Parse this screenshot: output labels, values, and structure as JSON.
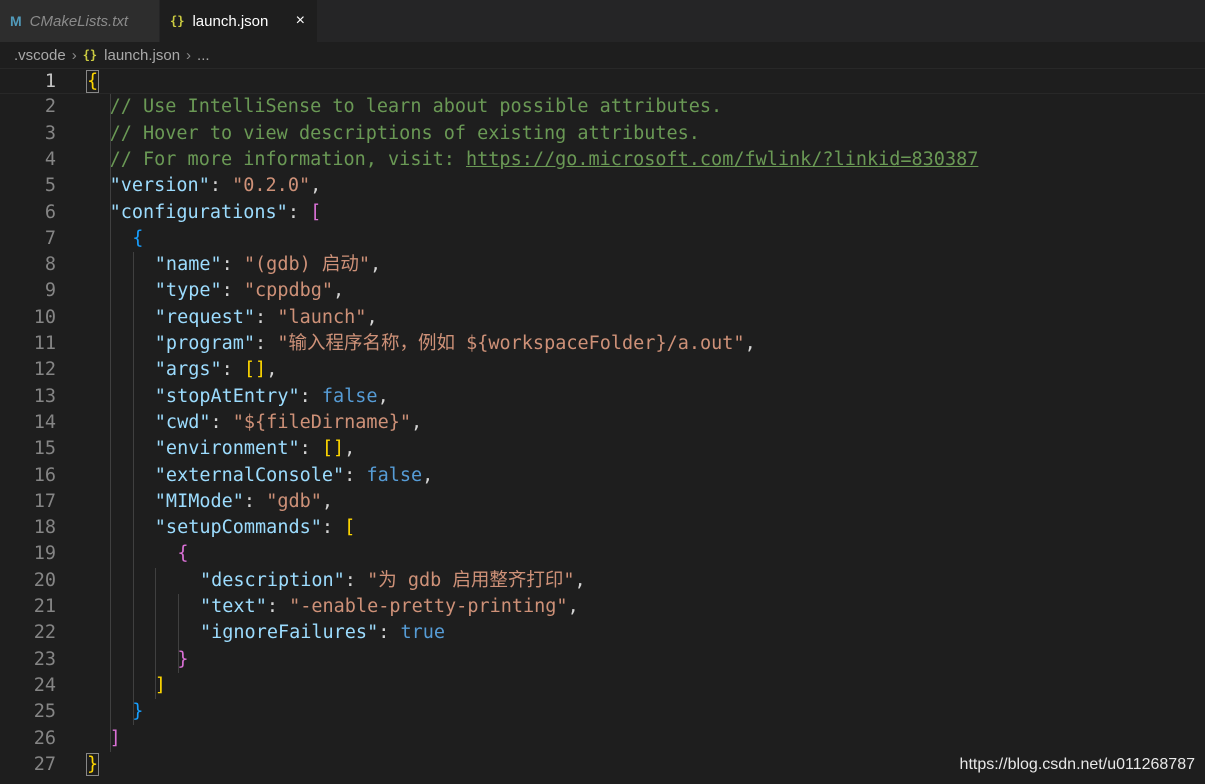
{
  "tabs": [
    {
      "label": "CMakeLists.txt",
      "icon": "M"
    },
    {
      "label": "launch.json",
      "icon": "{}",
      "close": "×"
    }
  ],
  "breadcrumb": {
    "folder": ".vscode",
    "file": "launch.json",
    "more": "..."
  },
  "editor": {
    "current_line": 1,
    "lines": [
      {
        "n": "1",
        "text": "{"
      },
      {
        "n": "2",
        "text": "// Use IntelliSense to learn about possible attributes."
      },
      {
        "n": "3",
        "text": "// Hover to view descriptions of existing attributes."
      },
      {
        "n": "4",
        "text": "// For more information, visit: https://go.microsoft.com/fwlink/?linkid=830387"
      },
      {
        "n": "5",
        "text": "\"version\": \"0.2.0\","
      },
      {
        "n": "6",
        "text": "\"configurations\": ["
      },
      {
        "n": "7",
        "text": "{"
      },
      {
        "n": "8",
        "text": "\"name\": \"(gdb) 启动\","
      },
      {
        "n": "9",
        "text": "\"type\": \"cppdbg\","
      },
      {
        "n": "10",
        "text": "\"request\": \"launch\","
      },
      {
        "n": "11",
        "text": "\"program\": \"输入程序名称，例如 ${workspaceFolder}/a.out\","
      },
      {
        "n": "12",
        "text": "\"args\": [],"
      },
      {
        "n": "13",
        "text": "\"stopAtEntry\": false,"
      },
      {
        "n": "14",
        "text": "\"cwd\": \"${fileDirname}\","
      },
      {
        "n": "15",
        "text": "\"environment\": [],"
      },
      {
        "n": "16",
        "text": "\"externalConsole\": false,"
      },
      {
        "n": "17",
        "text": "\"MIMode\": \"gdb\","
      },
      {
        "n": "18",
        "text": "\"setupCommands\": ["
      },
      {
        "n": "19",
        "text": "{"
      },
      {
        "n": "20",
        "text": "\"description\": \"为 gdb 启用整齐打印\","
      },
      {
        "n": "21",
        "text": "\"text\": \"-enable-pretty-printing\","
      },
      {
        "n": "22",
        "text": "\"ignoreFailures\": true"
      },
      {
        "n": "23",
        "text": "}"
      },
      {
        "n": "24",
        "text": "]"
      },
      {
        "n": "25",
        "text": "}"
      },
      {
        "n": "26",
        "text": "]"
      },
      {
        "n": "27",
        "text": "}"
      }
    ]
  },
  "watermark": "https://blog.csdn.net/u011268787",
  "colors": {
    "background": "#1e1e1e",
    "comment": "#6a9955",
    "key": "#9cdcfe",
    "string": "#ce9178",
    "boolean": "#569cd6",
    "bracket_level1": "#ffd700",
    "bracket_level2": "#da70d6",
    "bracket_level3": "#179fff"
  }
}
